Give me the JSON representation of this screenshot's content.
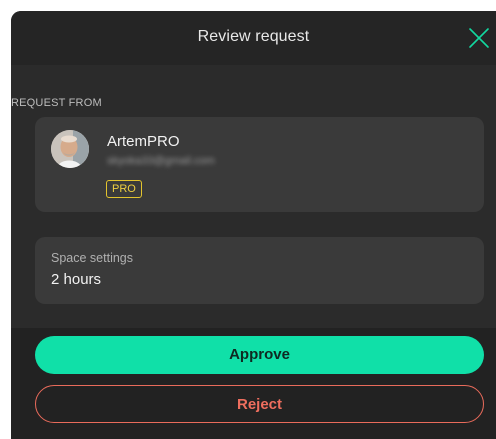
{
  "header": {
    "title": "Review request",
    "close_icon": "close-x-icon"
  },
  "request": {
    "section_label": "REQUEST FROM",
    "user": {
      "name": "ArtemPRO",
      "email": "skyoka33@gmail.com",
      "badge": "PRO",
      "avatar": "user-avatar-photo"
    }
  },
  "settings": {
    "label": "Space settings",
    "value": "2 hours"
  },
  "actions": {
    "approve_label": "Approve",
    "reject_label": "Reject"
  },
  "colors": {
    "accent": "#10e0a8",
    "danger": "#e96b5b",
    "badge": "#e3c42e",
    "background": "#2b2b2b",
    "card": "#3a3a3a"
  }
}
